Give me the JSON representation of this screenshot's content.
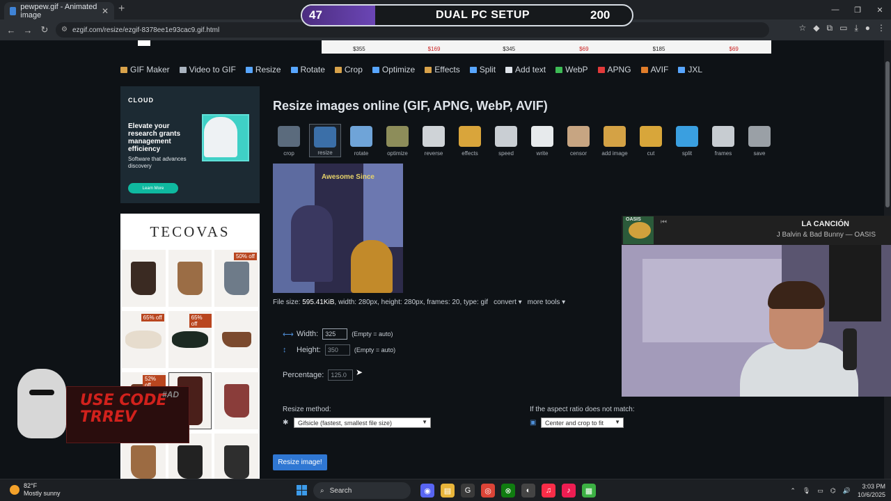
{
  "browser": {
    "tab_title": "pewpew.gif - Animated image",
    "url": "ezgif.com/resize/ezgif-8378ee1e93cac9.gif.html"
  },
  "overlay_banner": {
    "left_count": "47",
    "title": "DUAL PC SETUP",
    "right_count": "200",
    "accent": "#6b46b5"
  },
  "top_ad_prices": [
    "$355",
    "$169",
    "$345",
    "$69",
    "$185",
    "$69"
  ],
  "nav": [
    {
      "label": "GIF Maker",
      "icon": "gif-maker-icon",
      "color": "#d8a24a"
    },
    {
      "label": "Video to GIF",
      "icon": "video-icon",
      "color": "#aab4c0"
    },
    {
      "label": "Resize",
      "icon": "resize-icon",
      "color": "#58a6ff"
    },
    {
      "label": "Rotate",
      "icon": "rotate-icon",
      "color": "#58a6ff"
    },
    {
      "label": "Crop",
      "icon": "crop-icon",
      "color": "#d7a24a"
    },
    {
      "label": "Optimize",
      "icon": "optimize-icon",
      "color": "#58a6ff"
    },
    {
      "label": "Effects",
      "icon": "effects-icon",
      "color": "#d8a24a"
    },
    {
      "label": "Split",
      "icon": "split-icon",
      "color": "#58a6ff"
    },
    {
      "label": "Add text",
      "icon": "text-icon",
      "color": "#dfe4ea"
    },
    {
      "label": "WebP",
      "icon": "webp-icon",
      "color": "#3dbb55"
    },
    {
      "label": "APNG",
      "icon": "apng-icon",
      "color": "#e23a3a"
    },
    {
      "label": "AVIF",
      "icon": "avif-icon",
      "color": "#e07d2a"
    },
    {
      "label": "JXL",
      "icon": "jxl-icon",
      "color": "#58a6ff"
    }
  ],
  "left_ad": {
    "brand": "CLOUD",
    "headline": "Elevate your research grants management efficiency",
    "sub": "Software that advances discovery",
    "button": "Learn More"
  },
  "boots_ad": {
    "brand": "TECOVAS",
    "badges": [
      "50% off",
      "65% off",
      "65% off",
      "52% off"
    ]
  },
  "page_title": "Resize images online (GIF, APNG, WebP, AVIF)",
  "tools": [
    {
      "label": "crop",
      "icon": "crop-tool-icon",
      "color": "#5b6b7d"
    },
    {
      "label": "resize",
      "icon": "resize-tool-icon",
      "color": "#3b6fa8"
    },
    {
      "label": "rotate",
      "icon": "rotate-tool-icon",
      "color": "#6fa4d8"
    },
    {
      "label": "optimize",
      "icon": "optimize-tool-icon",
      "color": "#8d8d5a"
    },
    {
      "label": "reverse",
      "icon": "reverse-tool-icon",
      "color": "#cfd3d7"
    },
    {
      "label": "effects",
      "icon": "effects-tool-icon",
      "color": "#d9a53b"
    },
    {
      "label": "speed",
      "icon": "speed-tool-icon",
      "color": "#c9ced3"
    },
    {
      "label": "write",
      "icon": "write-tool-icon",
      "color": "#e7eaec"
    },
    {
      "label": "censor",
      "icon": "censor-tool-icon",
      "color": "#c7a582"
    },
    {
      "label": "add image",
      "icon": "add-image-tool-icon",
      "color": "#d4a245"
    },
    {
      "label": "cut",
      "icon": "cut-tool-icon",
      "color": "#d8a63a"
    },
    {
      "label": "split",
      "icon": "split-tool-icon",
      "color": "#3a9fe0"
    },
    {
      "label": "frames",
      "icon": "frames-tool-icon",
      "color": "#c7ccd1"
    },
    {
      "label": "save",
      "icon": "save-tool-icon",
      "color": "#9aa0a6"
    }
  ],
  "gif_text": "Awesome Since",
  "file_info": {
    "prefix": "File size:",
    "size": "595.41KiB",
    "details": ", width: 280px, height: 280px, frames: 20, type: gif",
    "convert": "convert ▾",
    "more_tools": "more tools ▾"
  },
  "form": {
    "width_label": "Width:",
    "width_value": "325",
    "height_label": "Height:",
    "height_value": "350",
    "empty_hint": "(Empty = auto)",
    "percentage_label": "Percentage:",
    "percentage_value": "125.0",
    "method_label": "Resize method:",
    "method_value": "Gifsicle (fastest, smallest file size)",
    "aspect_label": "If the aspect ratio does not match:",
    "aspect_value": "Center and crop to fit",
    "submit": "Resize image!"
  },
  "stream": {
    "song": "LA CANCIÓN",
    "artist": "J Balvin & Bad Bunny — OASIS",
    "album": "OASIS"
  },
  "promo": {
    "code_line1": "USE CODE",
    "code_line2": "TRREV",
    "ad_tag": "#AD"
  },
  "taskbar": {
    "temp": "82°F",
    "weather": "Mostly sunny",
    "search": "Search",
    "time": "3:03 PM",
    "date": "10/6/2025"
  }
}
